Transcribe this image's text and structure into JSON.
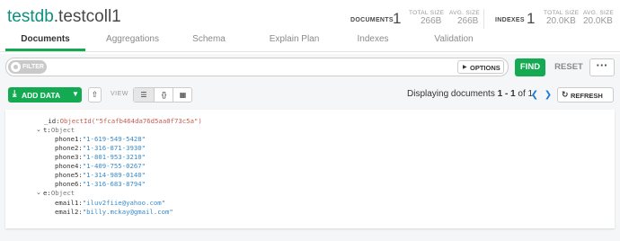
{
  "header": {
    "db": "testdb",
    "dot": ".",
    "collection": "testcoll1"
  },
  "stats": {
    "documents_label": "DOCUMENTS",
    "documents_count": "1",
    "doc_total_size_label": "TOTAL SIZE",
    "doc_total_size": "266B",
    "doc_avg_size_label": "AVG. SIZE",
    "doc_avg_size": "266B",
    "indexes_label": "INDEXES",
    "indexes_count": "1",
    "idx_total_size_label": "TOTAL SIZE",
    "idx_total_size": "20.0KB",
    "idx_avg_size_label": "AVG. SIZE",
    "idx_avg_size": "20.0KB"
  },
  "tabs": [
    {
      "label": "Documents"
    },
    {
      "label": "Aggregations"
    },
    {
      "label": "Schema"
    },
    {
      "label": "Explain Plan"
    },
    {
      "label": "Indexes"
    },
    {
      "label": "Validation"
    }
  ],
  "filter": {
    "pill_label": "FILTER",
    "options_label": "OPTIONS",
    "find_label": "FIND",
    "reset_label": "RESET",
    "more_label": "···"
  },
  "toolbar": {
    "add_data_label": "ADD DATA",
    "view_label": "VIEW",
    "displaying_prefix": "Displaying documents ",
    "range_start": "1",
    "range_sep": " - ",
    "range_end": "1",
    "of_text": " of ",
    "total": "1",
    "refresh_label": "REFRESH"
  },
  "document": {
    "id_key": "_id",
    "id_value": "ObjectId(\"5fcafb464da76d5aa0f73c5a\")",
    "t_key": "t",
    "t_type": "Object",
    "phones": [
      {
        "key": "phone1",
        "value": "\"1-619-549-5428\""
      },
      {
        "key": "phone2",
        "value": "\"1-316-871-3930\""
      },
      {
        "key": "phone3",
        "value": "\"1-801-953-3210\""
      },
      {
        "key": "phone4",
        "value": "\"1-409-755-0267\""
      },
      {
        "key": "phone5",
        "value": "\"1-314-989-0140\""
      },
      {
        "key": "phone6",
        "value": "\"1-316-683-8794\""
      }
    ],
    "e_key": "e",
    "e_type": "Object",
    "emails": [
      {
        "key": "email1",
        "value": "\"iluv2fiie@yahoo.com\""
      },
      {
        "key": "email2",
        "value": "\"billy.mckay@gmail.com\""
      }
    ]
  },
  "colors": {
    "accent_green": "#13aa52",
    "db_teal": "#0f8f7d",
    "objectid_red": "#c75b54",
    "string_blue": "#3a8ac9"
  }
}
